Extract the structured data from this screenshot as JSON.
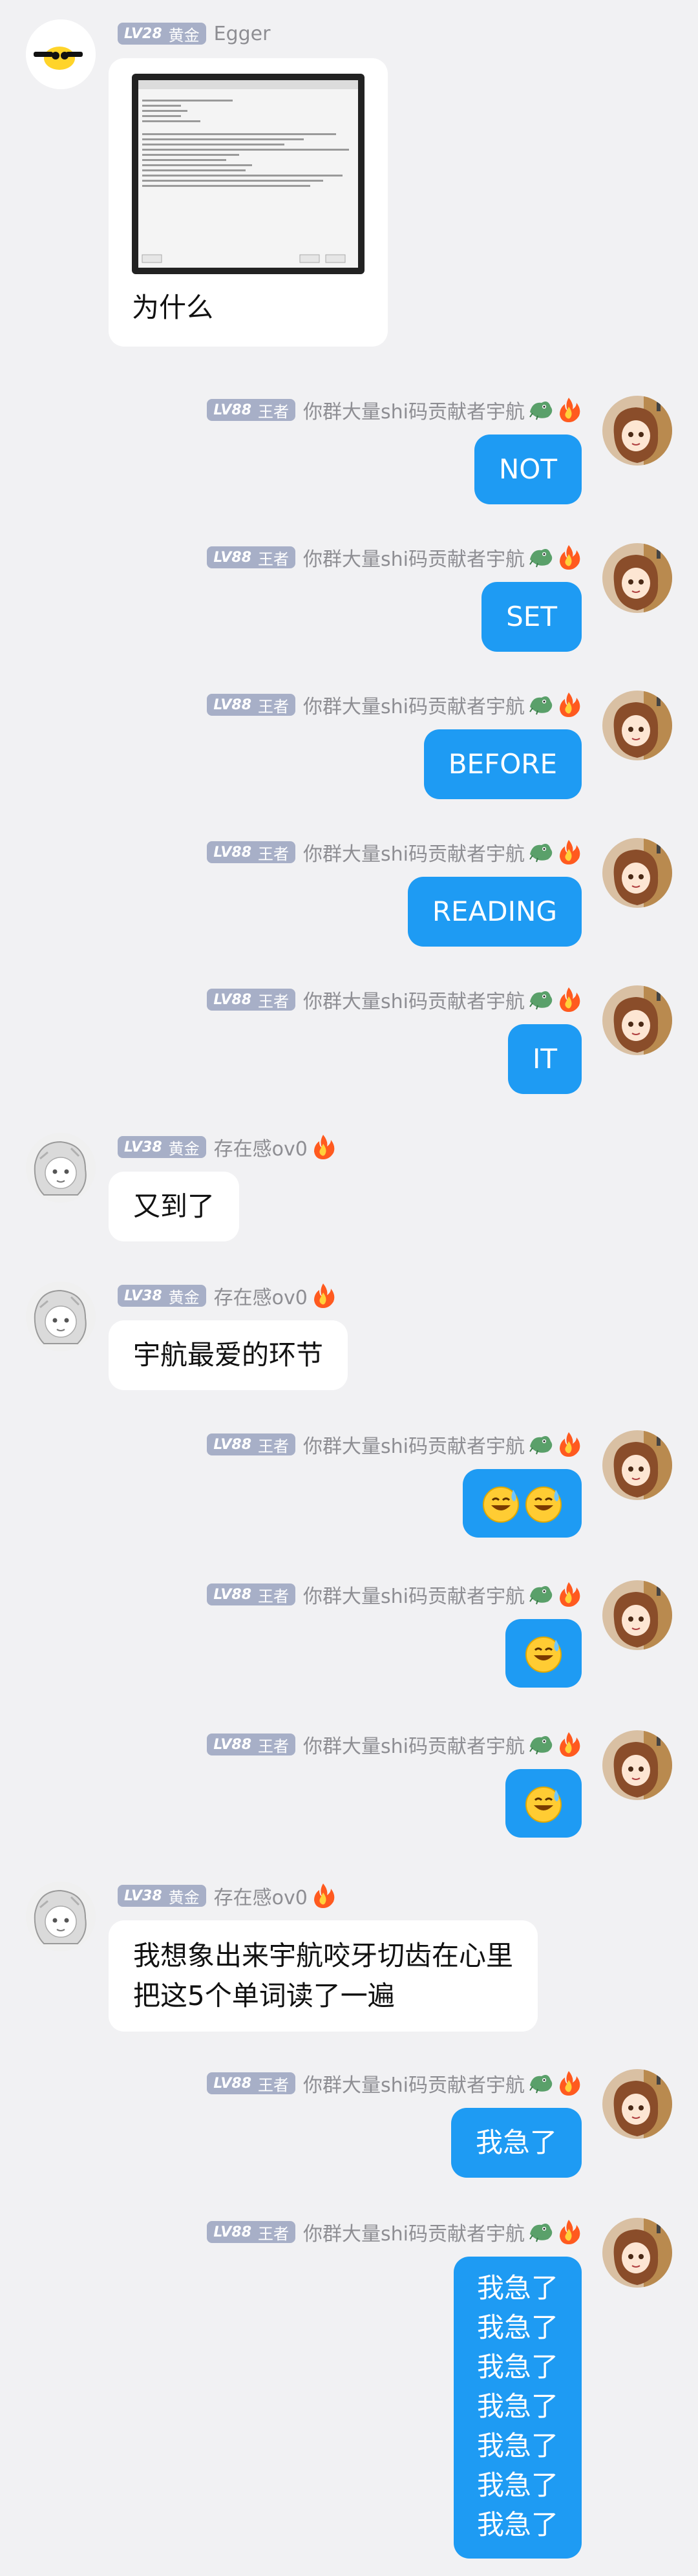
{
  "colors": {
    "background": "#f1f1f3",
    "outgoing_bubble": "#1e9bf3",
    "incoming_bubble": "#ffffff",
    "badge": "#a7afc7"
  },
  "users": {
    "egger": {
      "lv": "LV28",
      "rank": "黄金",
      "name": "Egger"
    },
    "yuhang": {
      "lv": "LV88",
      "rank": "王者",
      "name": "你群大量shi码贡献者宇航"
    },
    "ov0": {
      "lv": "LV38",
      "rank": "黄金",
      "name": "存在感ov0"
    }
  },
  "messages": [
    {
      "sender": "egger",
      "text": "为什么",
      "has_image": true
    },
    {
      "sender": "yuhang",
      "text": "NOT"
    },
    {
      "sender": "yuhang",
      "text": "SET"
    },
    {
      "sender": "yuhang",
      "text": "BEFORE"
    },
    {
      "sender": "yuhang",
      "text": "READING"
    },
    {
      "sender": "yuhang",
      "text": "IT"
    },
    {
      "sender": "ov0",
      "text": "又到了"
    },
    {
      "sender": "ov0",
      "text": "宇航最爱的环节"
    },
    {
      "sender": "yuhang",
      "emoji": "sweat-smile-emoji x2"
    },
    {
      "sender": "yuhang",
      "emoji": "sweat-smile-emoji"
    },
    {
      "sender": "yuhang",
      "emoji": "sweat-smile-emoji"
    },
    {
      "sender": "ov0",
      "line1": "我想象出来宇航咬牙切齿在心里",
      "line2": "把这5个单词读了一遍"
    },
    {
      "sender": "yuhang",
      "text": "我急了"
    },
    {
      "sender": "yuhang",
      "lines": [
        "我急了",
        "我急了",
        "我急了",
        "我急了",
        "我急了",
        "我急了",
        "我急了"
      ]
    }
  ]
}
